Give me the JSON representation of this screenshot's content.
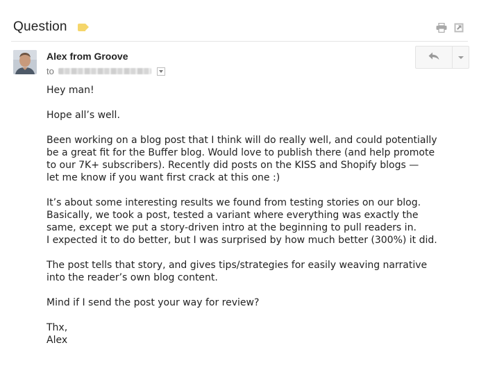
{
  "email": {
    "subject": "Question",
    "label_color": "#f5d66b",
    "sender_name": "Alex from Groove",
    "to_label": "to",
    "paragraphs": [
      "Hey man!",
      "Hope all’s well.",
      "Been working on a blog post that I think will do really well, and could potentially\nbe a great fit for the Buffer blog. Would love to publish there (and help promote\nto our 7K+ subscribers). Recently did posts on the KISS and Shopify blogs —\nlet me know if you want first crack at this one :)",
      "It’s about some interesting results we found from testing stories on our blog.\nBasically, we took a post, tested a variant where everything was exactly the\nsame, except we put a story-driven intro at the beginning to pull readers in.\nI expected it to do better, but I was surprised by how much better (300%) it did.",
      "The post tells that story, and gives tips/strategies for easily weaving narrative\ninto the reader’s own blog content.",
      "Mind if I send the post your way for review?",
      "Thx,\nAlex"
    ]
  },
  "icons": {
    "label": "label-tag-icon",
    "print": "print-icon",
    "new_window": "new-window-icon",
    "reply": "reply-icon",
    "more": "chevron-down-icon",
    "recipient_details": "caret-down-icon"
  }
}
